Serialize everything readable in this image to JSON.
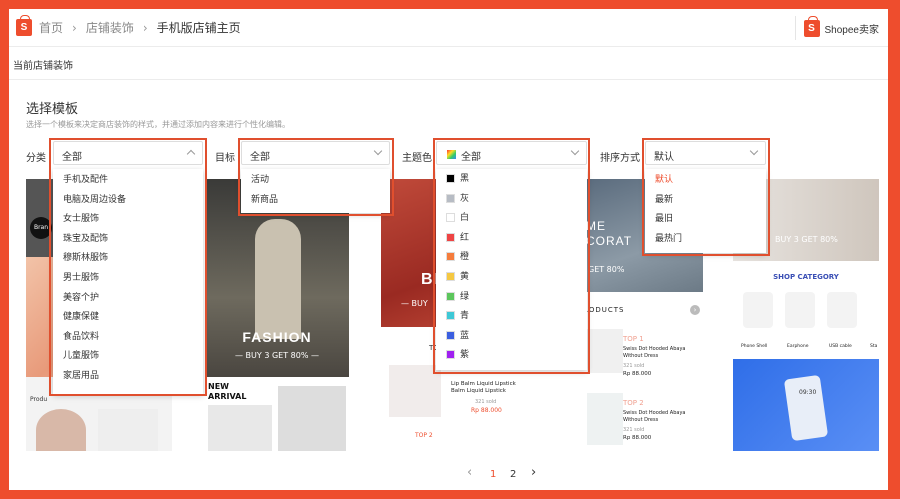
{
  "breadcrumb": {
    "home": "首页",
    "shop_decor": "店铺装饰",
    "current": "手机版店铺主页"
  },
  "seller_center": {
    "logo_glyph": "S",
    "label": "Shopee卖家"
  },
  "subheader": {
    "title": "当前店铺装饰"
  },
  "section": {
    "title": "选择模板",
    "description": "选择一个模板来决定商店装饰的样式，并通过添加内容来进行个性化编辑。"
  },
  "filters": {
    "category": {
      "label": "分类",
      "value": "全部",
      "options": [
        "手机及配件",
        "电脑及周边设备",
        "女士服饰",
        "珠宝及配饰",
        "穆斯林服饰",
        "男士服饰",
        "美容个护",
        "健康保健",
        "食品饮料",
        "儿童服饰",
        "家居用品"
      ]
    },
    "target": {
      "label": "目标",
      "value": "全部",
      "options": [
        "活动",
        "新商品"
      ]
    },
    "theme_color": {
      "label": "主题色",
      "value": "全部",
      "options": [
        {
          "label": "黑",
          "color": "#000000"
        },
        {
          "label": "灰",
          "color": "#b7bcc4"
        },
        {
          "label": "白",
          "color": "#ffffff"
        },
        {
          "label": "红",
          "color": "#ee4444"
        },
        {
          "label": "橙",
          "color": "#f57c3c"
        },
        {
          "label": "黄",
          "color": "#f5c842"
        },
        {
          "label": "绿",
          "color": "#5cc65c"
        },
        {
          "label": "青",
          "color": "#3ec8d6"
        },
        {
          "label": "蓝",
          "color": "#3b5fe0"
        },
        {
          "label": "紫",
          "color": "#a020f0"
        }
      ]
    },
    "sort": {
      "label": "排序方式",
      "value": "默认",
      "options": [
        "默认",
        "最新",
        "最旧",
        "最热门"
      ],
      "active_index": 0
    }
  },
  "templates": {
    "t1": {
      "brand_badge": "Bran",
      "product_label": "Produ"
    },
    "t2": {
      "headline": "FASHION",
      "promo": "— BUY 3 GET 80% —",
      "new_arrival": "NEW\nARRIVAL"
    },
    "t3": {
      "headline": "BR",
      "sub": "— BUY",
      "tag": "TO",
      "product_name": "Lip Balm Liquid Lipstick Balm Liquid Lipstick",
      "sold": "321 sold",
      "price": "Rp 88.000",
      "top2": "TOP 2"
    },
    "t4": {
      "headline": "ME\nCORAT",
      "promo": "GET 80%",
      "products_title": "RODUCTS",
      "items": [
        {
          "rank": "TOP 1",
          "name": "Swiss Dot Hooded Abaya Without Dress",
          "sold": "321 sold",
          "price": "Rp 88.000"
        },
        {
          "rank": "TOP 2",
          "name": "Swiss Dot Hooded Abaya Without Dress",
          "sold": "321 sold",
          "price": "Rp 88.000"
        }
      ]
    },
    "t5": {
      "promo": "BUY 3 GET 80%",
      "shop_category": "SHOP CATEGORY",
      "phone_time": "09:30",
      "categories": [
        "Phone Shell",
        "Earphone",
        "USB cable",
        "Sta"
      ]
    }
  },
  "pagination": {
    "pages": [
      "1",
      "2"
    ],
    "current": "1",
    "prev": "‹",
    "next": "›"
  },
  "colors": {
    "accent": "#ee4d2d",
    "highlight": "#e04f2e"
  }
}
